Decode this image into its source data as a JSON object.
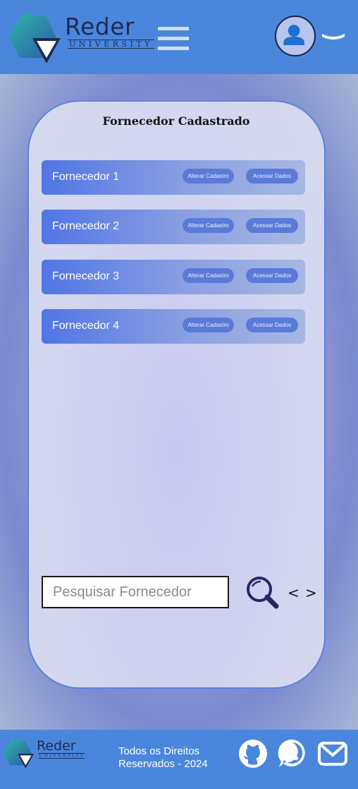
{
  "header": {
    "brand_name": "Reder",
    "brand_sub": "UNIVERSITY",
    "logo_icon": "reder-logo-icon",
    "menu_icon": "hamburger-menu-icon",
    "avatar_icon": "user-avatar-icon",
    "dropdown_icon": "chevron-down-icon"
  },
  "card": {
    "title": "Fornecedor Cadastrado",
    "suppliers": [
      {
        "label": "Fornecedor 1",
        "alter_label": "Alterar Cadastro",
        "access_label": "Acessar Dados"
      },
      {
        "label": "Fornecedor 2",
        "alter_label": "Alterar Cadastro",
        "access_label": "Acessar Dados"
      },
      {
        "label": "Fornecedor 3",
        "alter_label": "Alterar Cadastro",
        "access_label": "Acessar Dados"
      },
      {
        "label": "Fornecedor 4",
        "alter_label": "Alterar Cadastro",
        "access_label": "Acessar Dados"
      }
    ],
    "search": {
      "placeholder": "Pesquisar Fornecedor",
      "value": ""
    },
    "pager": {
      "prev": "<",
      "next": ">"
    }
  },
  "footer": {
    "brand_name": "Reder",
    "brand_sub": "UNIVERSITY",
    "rights_line1": "Todos os Direitos",
    "rights_line2": "Reservados - 2024",
    "icons": [
      "github-icon",
      "whatsapp-icon",
      "mail-icon"
    ]
  },
  "colors": {
    "header_bg": "#4a87dc",
    "row_gradient_start": "#5075e4",
    "pill_bg": "#5a7ad8",
    "search_icon": "#2a2766"
  }
}
